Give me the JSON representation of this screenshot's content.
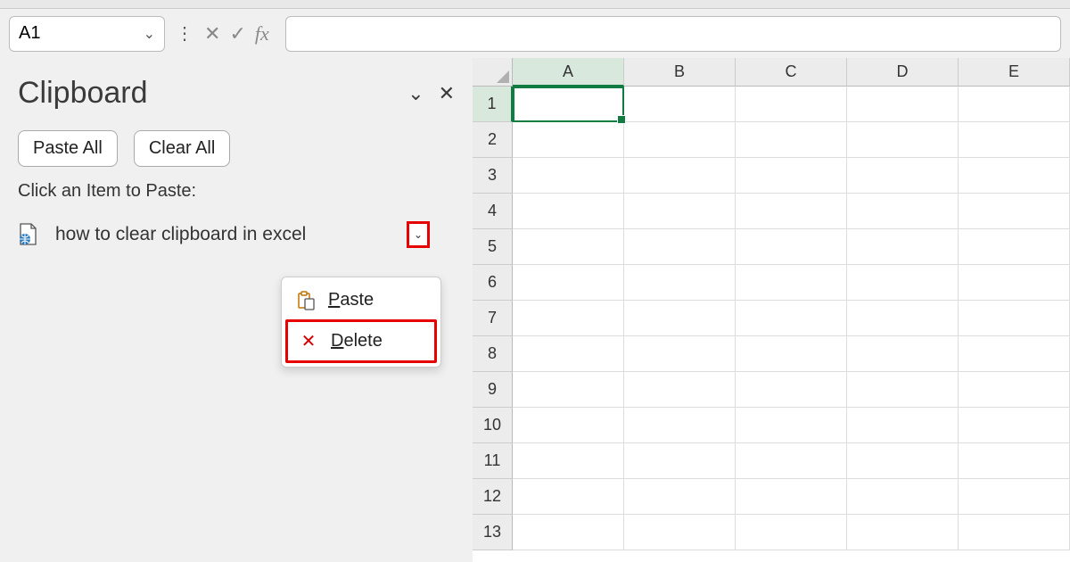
{
  "formula_bar": {
    "namebox_value": "A1",
    "fx_label": "fx",
    "formula_value": ""
  },
  "clipboard_pane": {
    "title": "Clipboard",
    "paste_all_label": "Paste All",
    "clear_all_label": "Clear All",
    "hint": "Click an Item to Paste:",
    "items": [
      {
        "text": "how to clear clipboard in excel"
      }
    ]
  },
  "context_menu": {
    "paste_label": "Paste",
    "delete_label": "Delete"
  },
  "grid": {
    "columns": [
      "A",
      "B",
      "C",
      "D",
      "E"
    ],
    "rows": [
      "1",
      "2",
      "3",
      "4",
      "5",
      "6",
      "7",
      "8",
      "9",
      "10",
      "11",
      "12",
      "13"
    ],
    "active_cell": "A1"
  }
}
